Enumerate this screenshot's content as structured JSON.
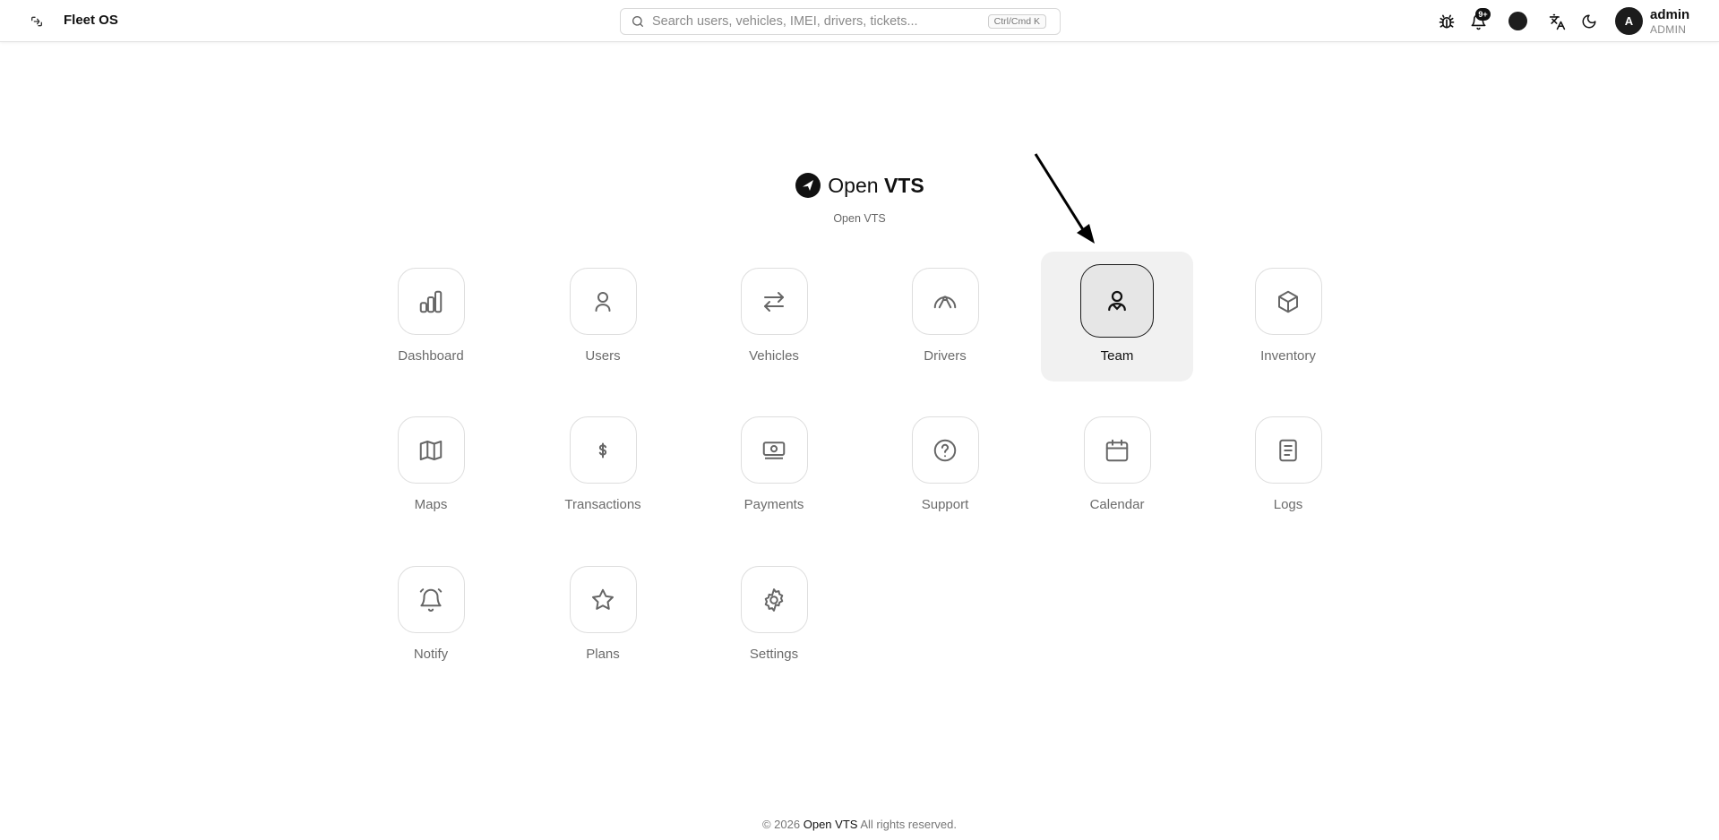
{
  "header": {
    "app_title": "Fleet OS",
    "search": {
      "placeholder": "Search users, vehicles, IMEI, drivers, tickets...",
      "shortcut": "Ctrl/Cmd K"
    },
    "notification_badge": "9+",
    "user": {
      "avatar_letter": "A",
      "name": "admin",
      "role": "ADMIN"
    }
  },
  "brand": {
    "name_prefix": "Open ",
    "name_bold": "VTS",
    "subtitle": "Open VTS"
  },
  "tiles": [
    {
      "label": "Dashboard",
      "icon": "bar-chart-icon"
    },
    {
      "label": "Users",
      "icon": "user-icon"
    },
    {
      "label": "Vehicles",
      "icon": "arrows-left-right-icon"
    },
    {
      "label": "Drivers",
      "icon": "steering-wheel-icon"
    },
    {
      "label": "Team",
      "icon": "user-group-icon",
      "active": true
    },
    {
      "label": "Inventory",
      "icon": "box-icon"
    },
    {
      "label": "Maps",
      "icon": "map-icon"
    },
    {
      "label": "Transactions",
      "icon": "dollar-icon"
    },
    {
      "label": "Payments",
      "icon": "banknote-icon"
    },
    {
      "label": "Support",
      "icon": "help-circle-icon"
    },
    {
      "label": "Calendar",
      "icon": "calendar-icon"
    },
    {
      "label": "Logs",
      "icon": "document-icon"
    },
    {
      "label": "Notify",
      "icon": "bell-ring-icon"
    },
    {
      "label": "Plans",
      "icon": "star-icon"
    },
    {
      "label": "Settings",
      "icon": "gear-icon"
    }
  ],
  "footer": {
    "copyright": "© 2026",
    "brand": "Open VTS",
    "rights": "All rights reserved."
  }
}
